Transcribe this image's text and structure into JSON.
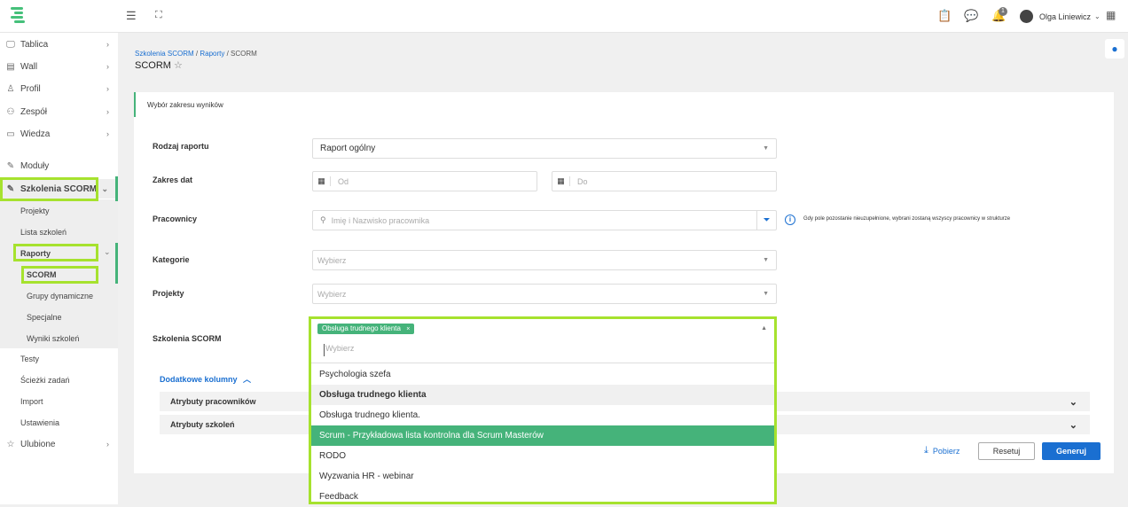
{
  "topbar": {
    "user_name": "Olga Liniewicz",
    "notification_count": "1"
  },
  "sidebar": {
    "items": [
      {
        "label": "Tablica"
      },
      {
        "label": "Wall"
      },
      {
        "label": "Profil"
      },
      {
        "label": "Zespół"
      },
      {
        "label": "Wiedza"
      },
      {
        "label": "Moduły"
      },
      {
        "label": "Szkolenia SCORM"
      }
    ],
    "sub_items": [
      "Projekty",
      "Lista szkoleń",
      "Raporty"
    ],
    "reports_items": [
      "SCORM",
      "Grupy dynamiczne",
      "Specjalne",
      "Wyniki szkoleń"
    ],
    "lower_items": [
      "Testy",
      "Ścieżki zadań",
      "Import",
      "Ustawienia"
    ],
    "favorites_label": "Ulubione"
  },
  "breadcrumb": {
    "part1": "Szkolenia SCORM",
    "sep": " / ",
    "part2": "Raporty",
    "part3": "SCORM"
  },
  "page_title": "SCORM",
  "card": {
    "section_title": "Wybór zakresu wyników",
    "report_type_label": "Rodzaj raportu",
    "report_type_value": "Raport ogólny",
    "date_range_label": "Zakres dat",
    "date_from_placeholder": "Od",
    "date_to_placeholder": "Do",
    "employees_label": "Pracownicy",
    "employees_placeholder": "Imię i Nazwisko pracownika",
    "employees_hint": "Gdy pole pozostanie nieuzupełnione, wybrani zostaną wszyscy pracownicy w strukturze",
    "categories_label": "Kategorie",
    "categories_placeholder": "Wybierz",
    "projects_label": "Projekty",
    "projects_placeholder": "Wybierz",
    "scorm_label": "Szkolenia SCORM",
    "scorm_tag": "Obsługa trudnego klienta",
    "scorm_search_placeholder": "Wybierz",
    "additional_columns": "Dodatkowe kolumny",
    "employee_attributes": "Atrybuty pracowników",
    "training_attributes": "Atrybuty szkoleń",
    "download_label": "Pobierz",
    "reset_label": "Resetuj",
    "generate_label": "Generuj"
  },
  "dropdown_options": [
    "Psychologia szefa",
    "Obsługa trudnego klienta",
    "Obsługa trudnego klienta.",
    "Scrum - Przykładowa lista kontrolna dla Scrum Masterów",
    "RODO",
    "Wyzwania HR - webinar",
    "Feedback"
  ],
  "colors": {
    "accent_green": "#45b37a",
    "highlight": "#a6e22e",
    "primary_blue": "#1a6fd1"
  }
}
